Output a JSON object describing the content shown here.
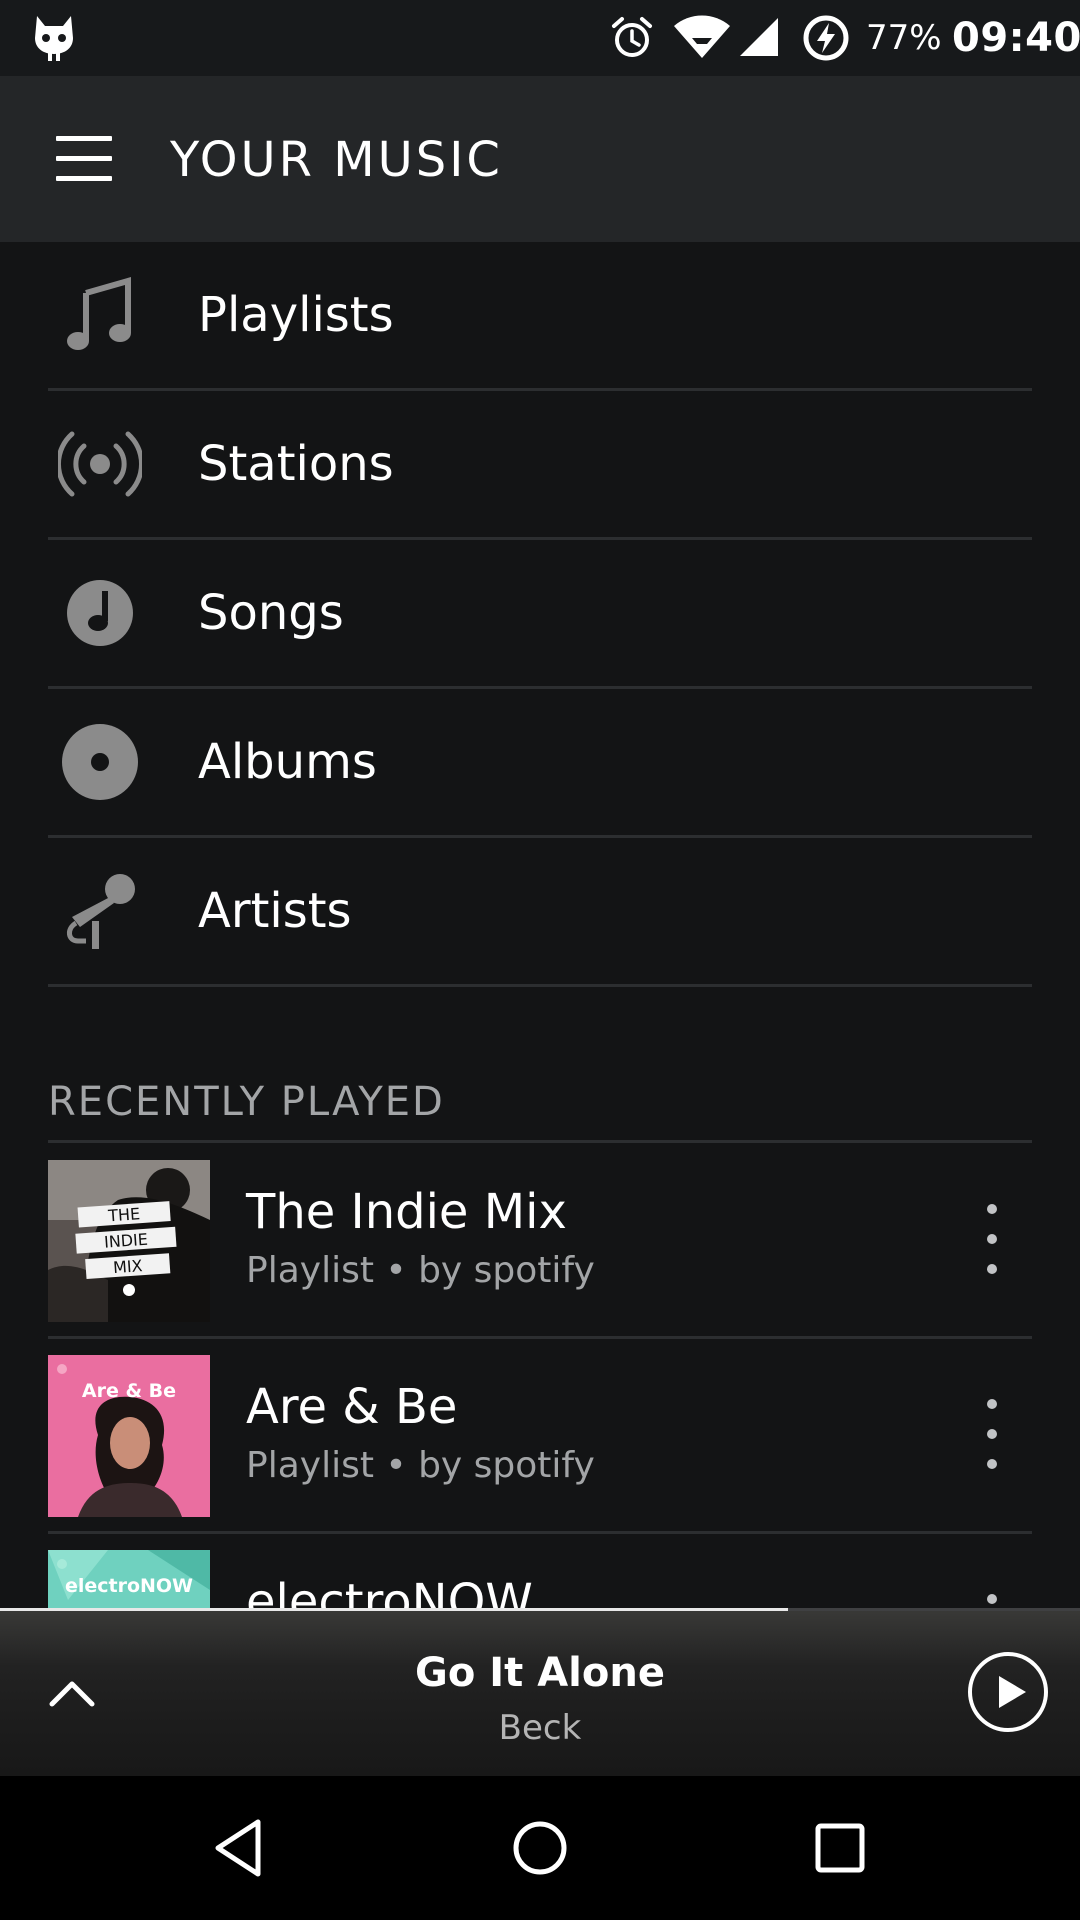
{
  "status_bar": {
    "battery_percent": "77%",
    "time": "09:40",
    "icons": [
      "cyanogen-cat-icon",
      "alarm-icon",
      "wifi-icon",
      "cell-signal-icon",
      "battery-charging-icon"
    ]
  },
  "header": {
    "title": "YOUR MUSIC",
    "menu_icon": "hamburger-menu-icon"
  },
  "library": {
    "items": [
      {
        "label": "Playlists",
        "icon": "music-note-icon"
      },
      {
        "label": "Stations",
        "icon": "radio-broadcast-icon"
      },
      {
        "label": "Songs",
        "icon": "song-disc-icon"
      },
      {
        "label": "Albums",
        "icon": "album-disc-icon"
      },
      {
        "label": "Artists",
        "icon": "microphone-icon"
      }
    ]
  },
  "recently_played": {
    "heading": "RECENTLY PLAYED",
    "items": [
      {
        "title": "The Indie Mix",
        "subtitle": "Playlist • by spotify",
        "cover_text": [
          "THE",
          "INDIE",
          "MIX"
        ]
      },
      {
        "title": "Are & Be",
        "subtitle": "Playlist • by spotify",
        "cover_text": [
          "Are & Be"
        ]
      },
      {
        "title": "electroNOW",
        "subtitle": "",
        "cover_text": [
          "electroNOW"
        ]
      }
    ]
  },
  "now_playing": {
    "title": "Go It Alone",
    "artist": "Beck",
    "progress": 0.73
  },
  "nav_bar": {
    "buttons": [
      "back-icon",
      "home-icon",
      "recents-icon"
    ]
  },
  "colors": {
    "background": "#131415",
    "top_bar": "#242628",
    "icon_gray": "#8b8b8b",
    "secondary_text": "#a3a5a7",
    "divider": "#2c2e30"
  }
}
